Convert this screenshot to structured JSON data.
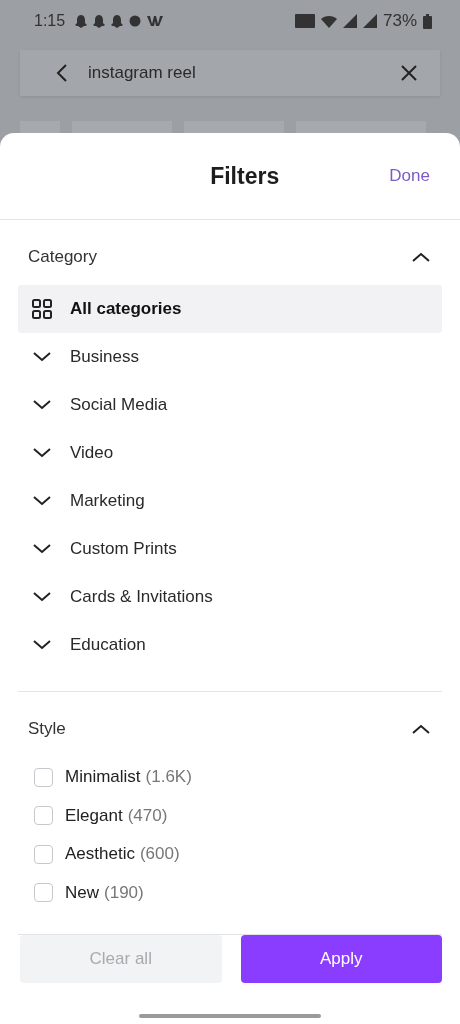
{
  "status_bar": {
    "time": "1:15",
    "battery": "73%"
  },
  "search": {
    "value": "instagram reel"
  },
  "sheet": {
    "title": "Filters",
    "done": "Done"
  },
  "sections": [
    {
      "title": "Category",
      "expanded": true,
      "kind": "tree",
      "items": [
        {
          "label": "All categories",
          "selected": true,
          "kind": "all"
        },
        {
          "label": "Business",
          "selected": false,
          "expanded": false,
          "kind": "group"
        },
        {
          "label": "Social Media",
          "selected": false,
          "expanded": false,
          "kind": "group"
        },
        {
          "label": "Video",
          "selected": false,
          "expanded": false,
          "kind": "group"
        },
        {
          "label": "Marketing",
          "selected": false,
          "expanded": false,
          "kind": "group"
        },
        {
          "label": "Custom Prints",
          "selected": false,
          "expanded": false,
          "kind": "group"
        },
        {
          "label": "Cards & Invitations",
          "selected": false,
          "expanded": false,
          "kind": "group"
        },
        {
          "label": "Education",
          "selected": false,
          "expanded": false,
          "kind": "group"
        }
      ]
    },
    {
      "title": "Style",
      "expanded": true,
      "kind": "checks",
      "items": [
        {
          "label": "Minimalist",
          "count": "(1.6K)",
          "checked": false
        },
        {
          "label": "Elegant",
          "count": "(470)",
          "checked": false
        },
        {
          "label": "Aesthetic",
          "count": "(600)",
          "checked": false
        },
        {
          "label": "New",
          "count": "(190)",
          "checked": false
        }
      ]
    }
  ],
  "buttons": {
    "clear": {
      "label": "Clear all",
      "disabled": true
    },
    "apply": {
      "label": "Apply"
    }
  }
}
